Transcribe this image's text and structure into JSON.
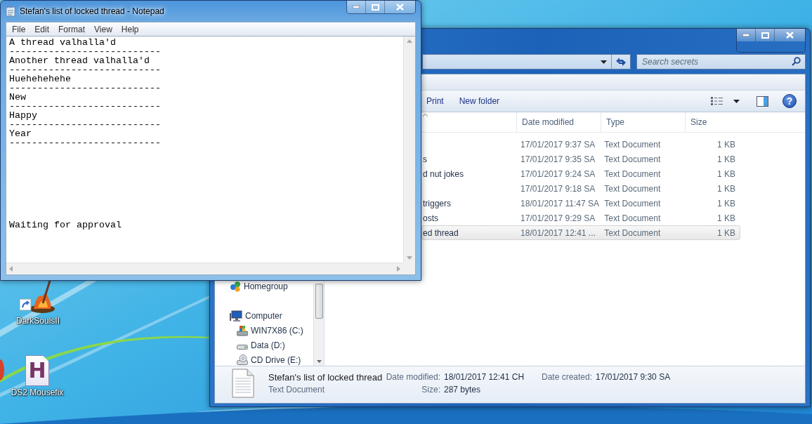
{
  "desktop": {
    "icons": [
      {
        "label": "DarkSoulsII",
        "kind": "shortcut"
      },
      {
        "label": "DS2 Mousefix",
        "kind": "document",
        "glyph": "H"
      }
    ]
  },
  "explorer": {
    "search": {
      "placeholder": "Search secrets"
    },
    "toolbar": [
      "Print",
      "New folder"
    ],
    "help_glyph": "?",
    "columns": [
      "Date modified",
      "Type",
      "Size"
    ],
    "rows": [
      {
        "date": "17/01/2017 9:37 SA",
        "type": "Text Document",
        "size": "1 KB",
        "selected": false
      },
      {
        "name": "s",
        "date": "17/01/2017 9:35 SA",
        "type": "Text Document",
        "size": "1 KB",
        "selected": false
      },
      {
        "name": "d nut jokes",
        "date": "17/01/2017 9:24 SA",
        "type": "Text Document",
        "size": "1 KB",
        "selected": false
      },
      {
        "date": "17/01/2017 9:18 SA",
        "type": "Text Document",
        "size": "1 KB",
        "selected": false
      },
      {
        "name": "triggers",
        "date": "18/01/2017 11:47 SA",
        "type": "Text Document",
        "size": "1 KB",
        "selected": false
      },
      {
        "name": "osts",
        "date": "17/01/2017 9:29 SA",
        "type": "Text Document",
        "size": "1 KB",
        "selected": false
      },
      {
        "name": "ed thread",
        "date": "18/01/2017 12:41 ...",
        "type": "Text Document",
        "size": "1 KB",
        "selected": true
      }
    ],
    "nav": [
      {
        "label": "Homegroup",
        "kind": "homegroup"
      },
      {
        "label": "Computer",
        "kind": "computer",
        "children": [
          {
            "label": "WIN7X86 (C:)",
            "kind": "system-drive"
          },
          {
            "label": "Data (D:)",
            "kind": "drive"
          },
          {
            "label": "CD Drive (E:)",
            "kind": "cd"
          }
        ]
      }
    ],
    "details": {
      "name": "Stefan's list of locked thread",
      "type": "Text Document",
      "fields": [
        {
          "label": "Date modified:",
          "value": "18/01/2017 12:41 CH"
        },
        {
          "label": "Size:",
          "value": "287 bytes"
        },
        {
          "label": "Date created:",
          "value": "17/01/2017 9:30 SA"
        }
      ]
    }
  },
  "notepad": {
    "title": "Stefan's list of locked thread - Notepad",
    "menu": [
      "File",
      "Edit",
      "Format",
      "View",
      "Help"
    ],
    "text": "A thread valhalla'd\n---------------------------\nAnother thread valhalla'd\n---------------------------\nHuehehehehe\n---------------------------\nNew\n---------------------------\nHappy\n---------------------------\nYear\n---------------------------\n\n\n\n\n\n\n\n\nWaiting for approval"
  }
}
